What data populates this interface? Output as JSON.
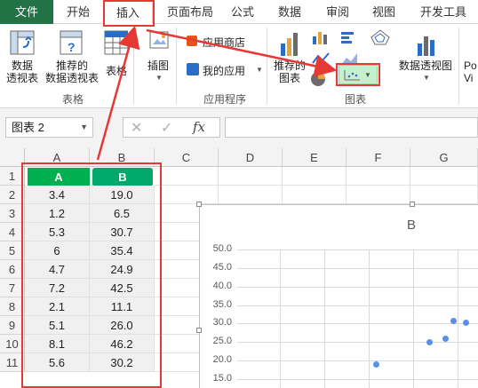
{
  "tabs": [
    "文件",
    "开始",
    "插入",
    "页面布局",
    "公式",
    "数据",
    "审阅",
    "视图",
    "开发工具"
  ],
  "ribbon": {
    "pivot_table": [
      "数据",
      "透视表"
    ],
    "recommended_pivot": [
      "推荐的",
      "数据透视表"
    ],
    "table": "表格",
    "group_table": "表格",
    "illustrations": "插图",
    "app_store": "应用商店",
    "my_apps": "我的应用",
    "group_apps": "应用程序",
    "recommended_charts": [
      "推荐的",
      "图表"
    ],
    "pivot_chart": "数据透视图",
    "group_charts": "图表",
    "power_view": [
      "Po",
      "Vi"
    ]
  },
  "formula_bar": {
    "name_box": "图表 2",
    "fx": "fx",
    "value": ""
  },
  "columns": [
    "A",
    "B",
    "C",
    "D",
    "E",
    "F",
    "G"
  ],
  "rows": [
    "1",
    "2",
    "3",
    "4",
    "5",
    "6",
    "7",
    "8",
    "9",
    "10",
    "11"
  ],
  "table": {
    "header_a": "A",
    "header_b": "B",
    "a": [
      "3.4",
      "1.2",
      "5.3",
      "6",
      "4.7",
      "7.2",
      "2.1",
      "5.1",
      "8.1",
      "5.6"
    ],
    "b": [
      "19.0",
      "6.5",
      "30.7",
      "35.4",
      "24.9",
      "42.5",
      "11.1",
      "26.0",
      "46.2",
      "30.2"
    ]
  },
  "colors": {
    "file_tab": "#217346",
    "header_a": "#00b050",
    "header_b": "#00a86b",
    "marker": "#5b8ee8",
    "annotation": "#e53935"
  },
  "chart_data": {
    "type": "scatter",
    "title": "B",
    "y_ticks": [
      "50.0",
      "45.0",
      "40.0",
      "35.0",
      "30.0",
      "25.0",
      "20.0",
      "15.0"
    ],
    "ylim": [
      15,
      50
    ],
    "points": [
      [
        3.4,
        19.0
      ],
      [
        5.1,
        26.0
      ],
      [
        4.7,
        24.9
      ],
      [
        5.3,
        30.7
      ],
      [
        5.6,
        30.2
      ]
    ]
  }
}
